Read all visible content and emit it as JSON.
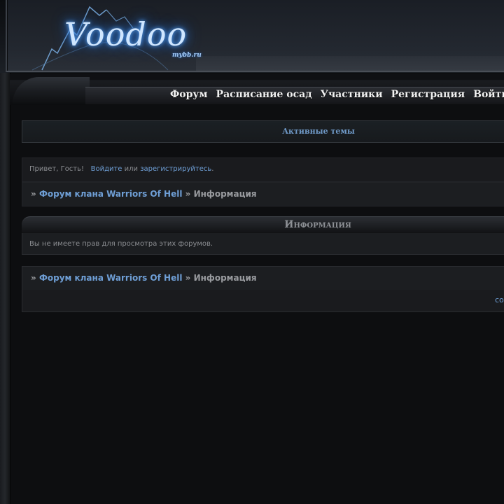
{
  "header": {
    "logo_text": "Voodoo",
    "logo_sub": "mybb.ru"
  },
  "nav": {
    "items": [
      {
        "label": "Форум"
      },
      {
        "label": "Расписание осад"
      },
      {
        "label": "Участники"
      },
      {
        "label": "Регистрация"
      },
      {
        "label": "Войти"
      }
    ]
  },
  "active_topics": {
    "label": "Активные темы"
  },
  "welcome": {
    "greeting": "Привет, Гость!",
    "login_link": "Войдите",
    "or": "или",
    "register_link": "зарегистрируйтесь",
    "end": "."
  },
  "breadcrumb": {
    "sep": "»",
    "forum_link": "Форум клана Warriors Of Hell",
    "current": "Информация"
  },
  "section": {
    "title": "Информация",
    "message": "Вы не имеете прав для просмотра этих форумов."
  },
  "footer": {
    "link": "co"
  },
  "colors": {
    "link": "#6f9fd6",
    "text": "#8a8c90",
    "background": "#0d0e10"
  }
}
